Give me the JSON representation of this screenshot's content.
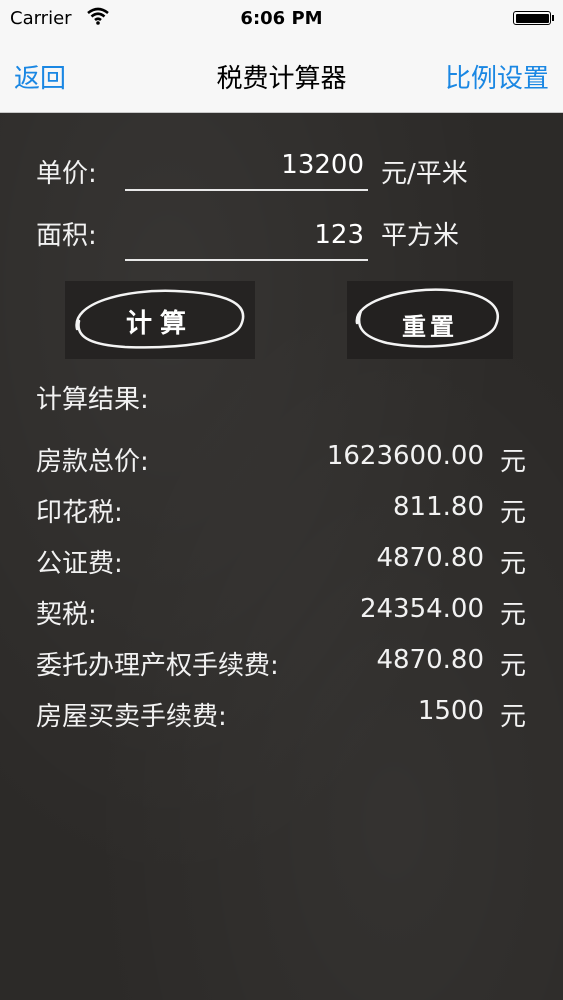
{
  "status_bar": {
    "carrier": "Carrier",
    "time": "6:06 PM"
  },
  "nav": {
    "back": "返回",
    "title": "税费计算器",
    "right": "比例设置"
  },
  "form": {
    "price_label": "单价:",
    "price_value": "13200",
    "price_unit": "元/平米",
    "area_label": "面积:",
    "area_value": "123",
    "area_unit": "平方米"
  },
  "buttons": {
    "calc": "计算",
    "reset": "重置"
  },
  "results": {
    "heading": "计算结果:",
    "rows": [
      {
        "label": "房款总价:",
        "value": "1623600.00",
        "unit": "元"
      },
      {
        "label": "印花税:",
        "value": "811.80",
        "unit": "元"
      },
      {
        "label": "公证费:",
        "value": "4870.80",
        "unit": "元"
      },
      {
        "label": "契税:",
        "value": "24354.00",
        "unit": "元"
      },
      {
        "label": "委托办理产权手续费:",
        "value": "4870.80",
        "unit": "元"
      },
      {
        "label": "房屋买卖手续费:",
        "value": "1500",
        "unit": "元"
      }
    ]
  },
  "colors": {
    "accent": "#1a87e3",
    "board": "#2c2a28",
    "chalk": "#f2f2f2"
  }
}
